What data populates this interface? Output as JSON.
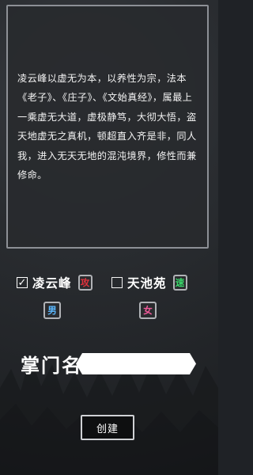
{
  "description": {
    "text": "凌云峰以虚无为本，以养性为宗，法本《老子》、《庄子》、《文始真经》，属最上一乘虚无大道，虚极静笃，大彻大悟，盗天地虚无之真机，顿超直入齐是非，同人我，进入无天无地的混沌境界，修性而兼修命。"
  },
  "sects": [
    {
      "name": "凌云峰",
      "checked": true,
      "check_glyph": "✓",
      "attribute": "攻",
      "attribute_color": "#e2323c",
      "gender": "男",
      "gender_color": "#5bb8ff"
    },
    {
      "name": "天池苑",
      "checked": false,
      "check_glyph": "",
      "attribute": "速",
      "attribute_color": "#39d96b",
      "gender": "女",
      "gender_color": "#f05a9a"
    }
  ],
  "form": {
    "name_label": "掌门名",
    "name_value": "",
    "name_placeholder": ""
  },
  "actions": {
    "create_label": "创建"
  }
}
